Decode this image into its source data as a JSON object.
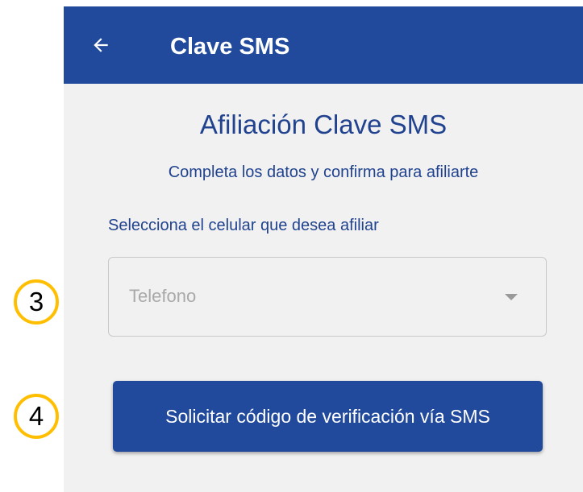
{
  "app_bar": {
    "title": "Clave SMS",
    "back_icon": "arrow-left-icon",
    "background": "#214a9c"
  },
  "content": {
    "heading": "Afiliación Clave SMS",
    "subheading": "Completa los datos y confirma para afiliarte",
    "select_label": "Selecciona el celular que desea afiliar",
    "phone_select": {
      "placeholder": "Telefono",
      "caret_icon": "caret-down-icon"
    },
    "request_button": "Solicitar código de verificación vía SMS"
  },
  "annotations": {
    "step_3": "3",
    "step_4": "4",
    "marker_color": "#ffbf00"
  },
  "colors": {
    "primary": "#214a9c",
    "text_accent": "#21438f",
    "background": "#f1f1f1"
  }
}
